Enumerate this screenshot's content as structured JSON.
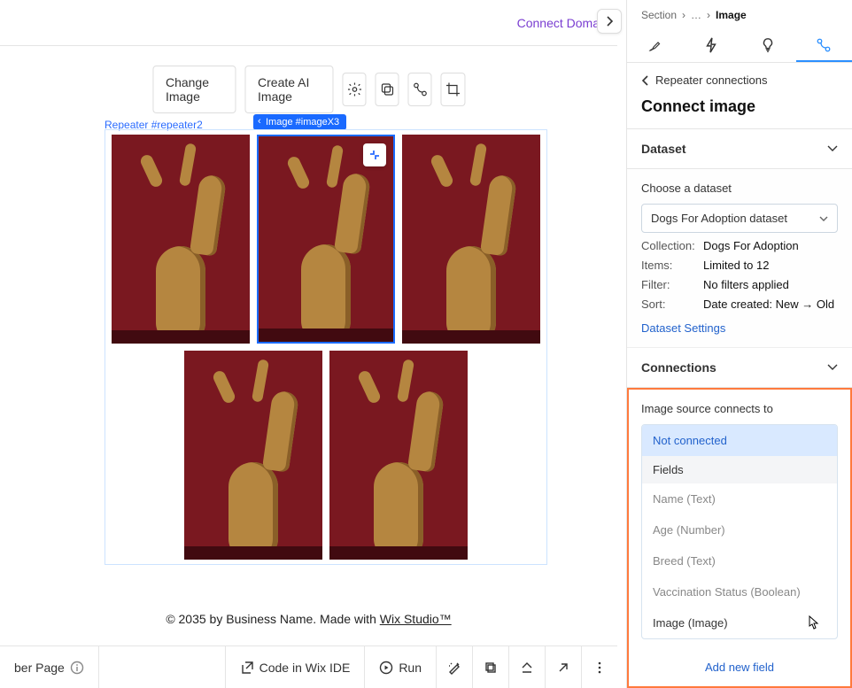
{
  "topbar": {
    "connect_domain": "Connect Doma"
  },
  "toolbar": {
    "change_image": "Change Image",
    "create_ai_image": "Create AI Image"
  },
  "repeater_label": "Repeater #repeater2",
  "image_tag": "Image #imageX3",
  "footer": {
    "prefix": "© 2035 by Business Name. Made with ",
    "link": "Wix Studio™"
  },
  "bottombar": {
    "page_label": "ber Page",
    "code_ide": "Code in Wix IDE",
    "run": "Run"
  },
  "breadcrumb": {
    "root": "Section",
    "mid": "…",
    "current": "Image"
  },
  "panel": {
    "back": "Repeater connections",
    "title": "Connect image",
    "dataset_head": "Dataset",
    "choose_dataset": "Choose a dataset",
    "dataset_name": "Dogs For Adoption dataset",
    "collection_k": "Collection:",
    "collection_v": "Dogs For Adoption",
    "items_k": "Items:",
    "items_v": "Limited to 12",
    "filter_k": "Filter:",
    "filter_v": "No filters applied",
    "sort_k": "Sort:",
    "sort_v": "Date created: New → Old",
    "dataset_settings": "Dataset Settings",
    "connections_head": "Connections",
    "conn_label": "Image source connects to",
    "not_connected": "Not connected",
    "fields_header": "Fields",
    "fields": [
      "Name (Text)",
      "Age (Number)",
      "Breed (Text)",
      "Vaccination Status (Boolean)",
      "Image (Image)"
    ],
    "add_new_field": "Add new field"
  }
}
